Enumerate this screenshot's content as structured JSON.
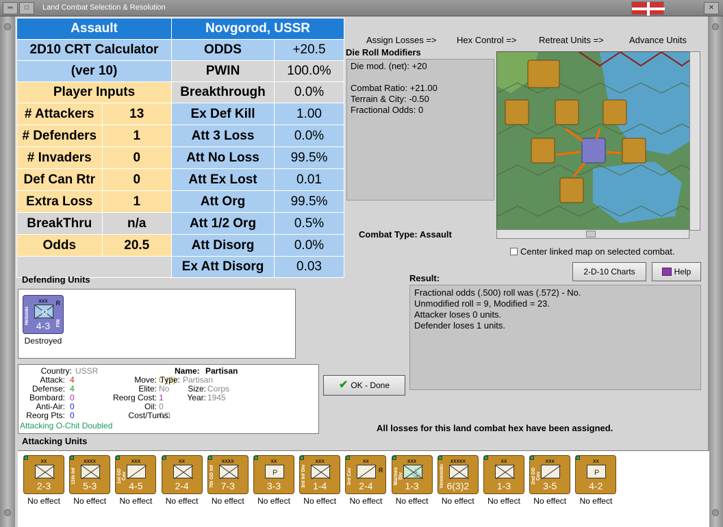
{
  "window": {
    "title": "Land Combat Selection & Resolution"
  },
  "calculator": {
    "header_left": "Assault",
    "header_right": "Novgorod, USSR",
    "crt_title": "2D10 CRT Calculator",
    "crt_version": "(ver 10)",
    "player_inputs": "Player Inputs",
    "inputs": [
      {
        "label": "# Attackers",
        "value": "13"
      },
      {
        "label": "# Defenders",
        "value": "1"
      },
      {
        "label": "# Invaders",
        "value": "0"
      },
      {
        "label": "Def Can Rtr",
        "value": "0"
      },
      {
        "label": "Extra Loss",
        "value": "1"
      },
      {
        "label": "BreakThru",
        "value": "n/a"
      },
      {
        "label": "Odds",
        "value": "20.5"
      }
    ],
    "results": [
      {
        "label": "ODDS",
        "value": "+20.5"
      },
      {
        "label": "PWIN",
        "value": "100.0%"
      },
      {
        "label": "Breakthrough",
        "value": "0.0%"
      },
      {
        "label": "Ex Def Kill",
        "value": "1.00"
      },
      {
        "label": "Att 3 Loss",
        "value": "0.0%"
      },
      {
        "label": "Att No Loss",
        "value": "99.5%"
      },
      {
        "label": "Att Ex Lost",
        "value": "0.01"
      },
      {
        "label": "Att Org",
        "value": "99.5%"
      },
      {
        "label": "Att 1/2 Org",
        "value": "0.5%"
      },
      {
        "label": "Att Disorg",
        "value": "0.0%"
      },
      {
        "label": "Ex Att Disorg",
        "value": "0.03"
      }
    ]
  },
  "actions": [
    "Assign Losses =>",
    "Hex Control =>",
    "Retreat Units =>",
    "Advance Units"
  ],
  "die_roll": {
    "title": "Die Roll Modifiers",
    "lines": [
      "Die mod. (net): +20",
      "",
      "Combat Ratio: +21.00",
      "Terrain & City: -0.50",
      "Fractional Odds: 0"
    ]
  },
  "combat_type_label": "Combat Type:",
  "combat_type": "Assault",
  "center_link_label": "Center linked map on selected combat.",
  "charts_button": "2-D-10 Charts",
  "help_button": "Help",
  "result": {
    "title": "Result:",
    "lines": [
      "Fractional odds (.500) roll was (.572)  - No.",
      "Unmodified roll = 9, Modified = 23.",
      "Attacker loses 0 units.",
      "Defender loses 1 units."
    ]
  },
  "defending": {
    "title": "Defending Units",
    "unit": {
      "size": "xxx",
      "name": "Helsinki",
      "nation": "FIN",
      "strength": "4-3",
      "side_letter": "R",
      "status": "Destroyed"
    }
  },
  "info": {
    "country_label": "Country:",
    "country": "USSR",
    "attack_label": "Attack:",
    "attack": "4",
    "defense_label": "Defense:",
    "defense": "4",
    "bombard_label": "Bombard:",
    "bombard": "0",
    "antiair_label": "Anti-Air:",
    "antiair": "0",
    "reorgpts_label": "Reorg Pts:",
    "reorgpts": "0",
    "name_label": "Name:",
    "name": "Partisan",
    "move_label": "Move:",
    "move": "0 (2)",
    "elite_label": "Elite:",
    "elite": "No",
    "reorgcost_label": "Reorg Cost:",
    "reorgcost": "1",
    "oil_label": "Oil:",
    "oil": "0",
    "costturns_label": "Cost/Turns:",
    "costturns": "0/0",
    "type_label": "Type:",
    "type": "Partisan",
    "size_label": "Size:",
    "size": "Corps",
    "year_label": "Year:",
    "year": "1945",
    "note": "Attacking O-Chit Doubled"
  },
  "ok_button": "OK - Done",
  "losses_message": "All losses for this land combat hex have been assigned.",
  "attacking": {
    "title": "Attacking Units",
    "units": [
      {
        "size": "xx",
        "name": "",
        "strength": "2-3",
        "sym": "inf",
        "status": "No effect"
      },
      {
        "size": "xxxx",
        "name": "11th Inf",
        "strength": "5-3",
        "sym": "inf",
        "status": "No effect"
      },
      {
        "size": "xxx",
        "name": "1st GD Cav",
        "strength": "4-5",
        "sym": "cav",
        "status": "No effect"
      },
      {
        "size": "xx",
        "name": "",
        "strength": "2-4",
        "sym": "inf",
        "status": "No effect"
      },
      {
        "size": "xxxx",
        "name": "7th GD Inf",
        "strength": "7-3",
        "sym": "inf",
        "status": "No effect"
      },
      {
        "size": "xx",
        "name": "",
        "strength": "3-3",
        "sym": "par",
        "status": "No effect"
      },
      {
        "size": "xxx",
        "name": "3rd Inf Div",
        "strength": "1-4",
        "sym": "inf",
        "status": "No effect"
      },
      {
        "size": "xx",
        "name": "3rd Cav",
        "strength": "2-4",
        "sym": "cav",
        "side": "R",
        "status": "No effect"
      },
      {
        "size": "xxx",
        "name": "Marines Div",
        "strength": "1-3",
        "sym": "mar",
        "status": "No effect"
      },
      {
        "size": "xxxxx",
        "name": "Yeremenko",
        "strength": "6(3)2",
        "sym": "inf",
        "status": "No effect"
      },
      {
        "size": "xx",
        "name": "",
        "strength": "1-3",
        "sym": "inf",
        "status": "No effect"
      },
      {
        "size": "xxx",
        "name": "2nd GD Cav",
        "strength": "3-5",
        "sym": "cav",
        "status": "No effect"
      },
      {
        "size": "xx",
        "name": "",
        "strength": "4-2",
        "sym": "par",
        "status": "No effect"
      }
    ]
  },
  "colors": {
    "header_blue": "#1f7dd6",
    "light_blue": "#a9cdf0",
    "yellow": "#fde0a0",
    "grey": "#d6d6d6",
    "unit_tan": "#c38d2a",
    "def_blue": "#7b7bc8"
  }
}
